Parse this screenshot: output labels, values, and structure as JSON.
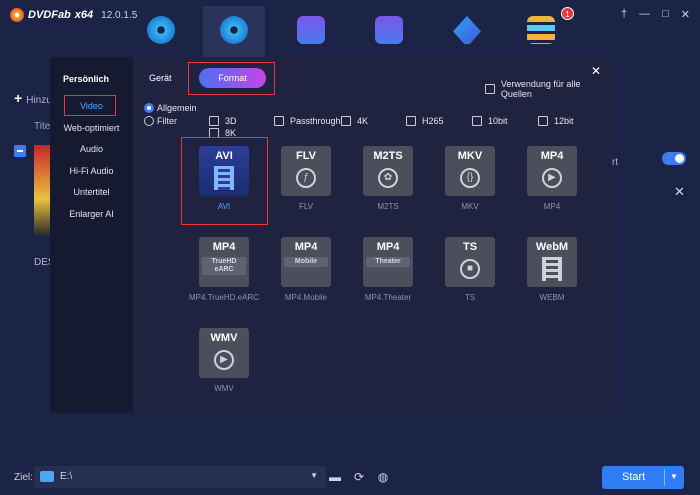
{
  "app": {
    "name": "DVDFab",
    "variant": "x64",
    "version": "12.0.1.5",
    "notification_count": "1"
  },
  "window_controls": [
    "†",
    "—",
    "□",
    "✕"
  ],
  "top_nav": [
    {
      "icon": "copy-disc-icon"
    },
    {
      "icon": "ripper-disc-icon",
      "active": true
    },
    {
      "icon": "converter-film-icon"
    },
    {
      "icon": "creator-film-icon"
    },
    {
      "icon": "launchpad-rocket-icon"
    },
    {
      "icon": "toolbox-bars-icon"
    }
  ],
  "background": {
    "add_label": "Hinzufü",
    "col_title": "Titel",
    "item_label": "DES",
    "right_text": "rt"
  },
  "modal": {
    "sidebar_title": "Persönlich",
    "sidebar_items": [
      "Video",
      "Web-optimiert",
      "Audio",
      "Hi-Fi Audio",
      "Untertitel",
      "Enlarger AI"
    ],
    "tab_device": "Gerät",
    "tab_format": "Format",
    "use_all_sources": "Verwendung für alle Quellen",
    "radio_general": "Allgemein",
    "radio_filter": "Filter",
    "filters": [
      "3D",
      "Passthrough",
      "4K",
      "H265",
      "10bit",
      "12bit",
      "8K"
    ],
    "formats": [
      {
        "code": "AVI",
        "label": "AVI",
        "glyph": "film",
        "selected": true
      },
      {
        "code": "FLV",
        "label": "FLV",
        "glyph": "flash"
      },
      {
        "code": "M2TS",
        "label": "M2TS",
        "glyph": "reel"
      },
      {
        "code": "MKV",
        "label": "MKV",
        "glyph": "mkv"
      },
      {
        "code": "MP4",
        "label": "MP4",
        "glyph": "play"
      },
      {
        "code": "MP4",
        "sub": "TrueHD eARC",
        "label": "MP4.TrueHD.eARC"
      },
      {
        "code": "MP4",
        "sub": "Mobile",
        "label": "MP4.Mobile"
      },
      {
        "code": "MP4",
        "sub": "Theater",
        "label": "MP4.Theater"
      },
      {
        "code": "TS",
        "label": "TS",
        "glyph": "camera"
      },
      {
        "code": "WebM",
        "label": "WEBM",
        "glyph": "film"
      },
      {
        "code": "WMV",
        "label": "WMV",
        "glyph": "play"
      }
    ]
  },
  "bottom": {
    "target_label": "Ziel:",
    "target_path": "E:\\",
    "start_label": "Start"
  }
}
